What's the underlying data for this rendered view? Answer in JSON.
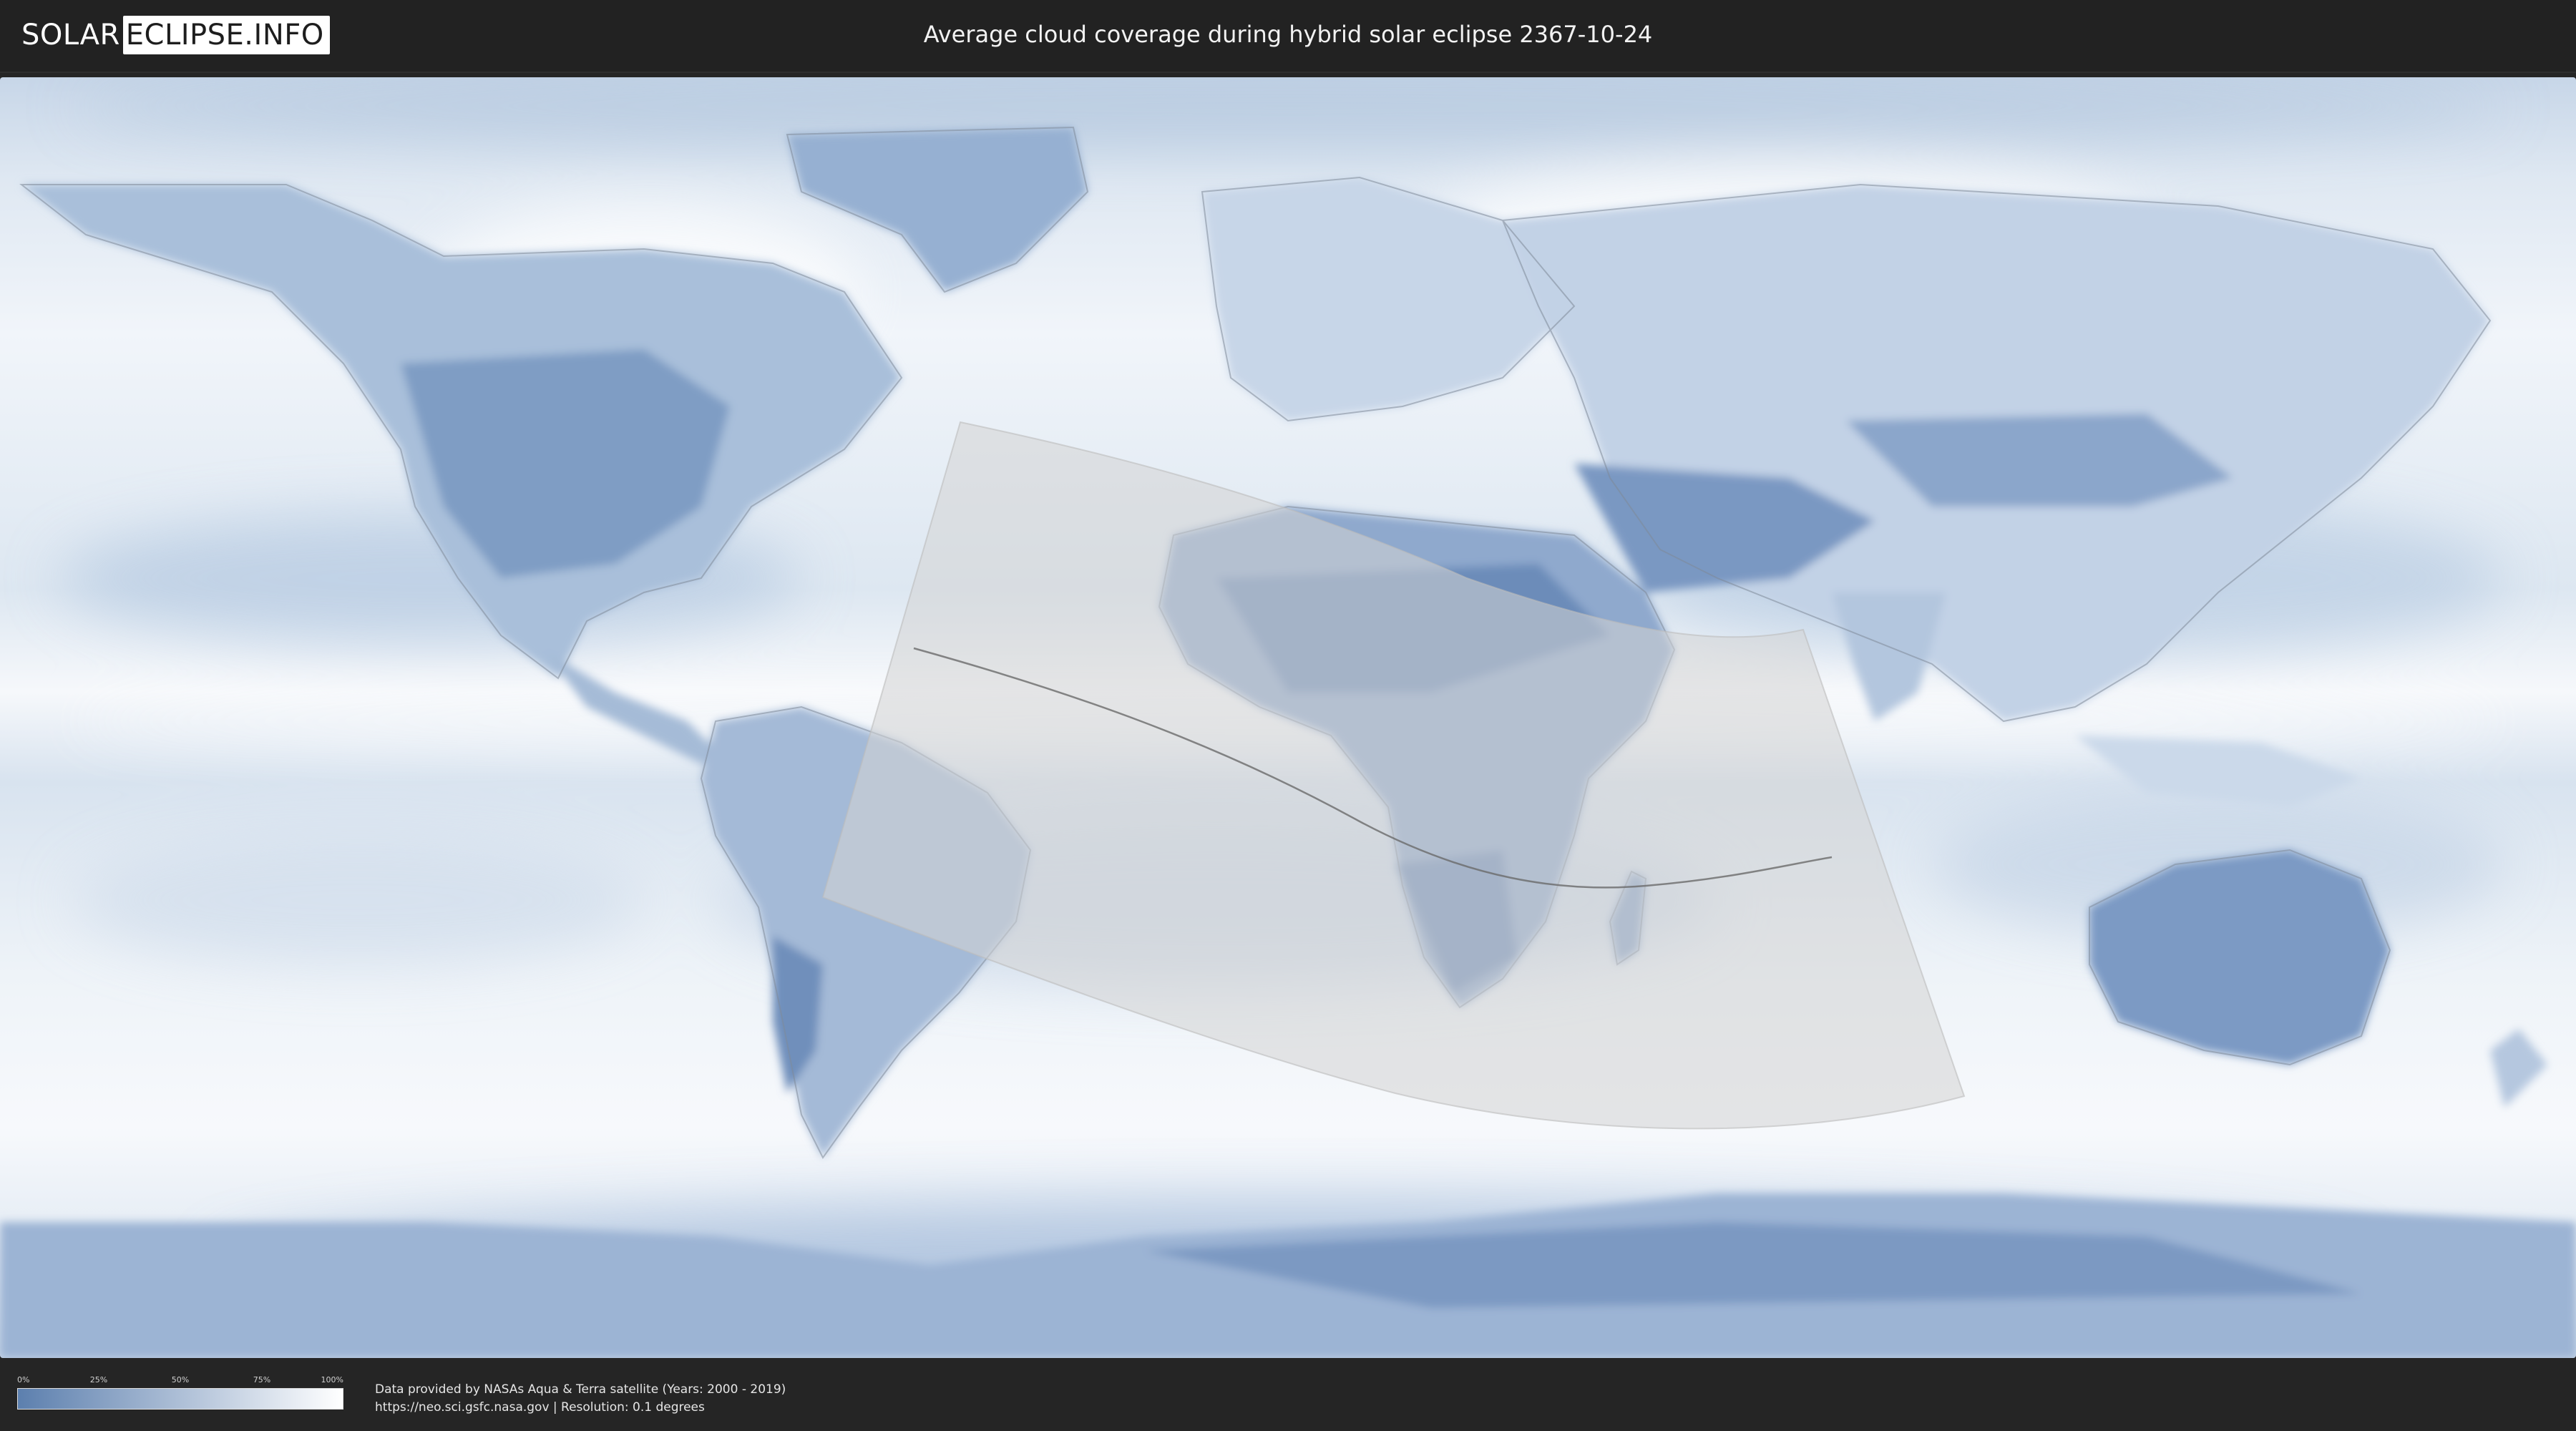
{
  "header": {
    "logo_left": "SOLAR",
    "logo_right": "ECLIPSE.INFO",
    "title": "Average cloud coverage during hybrid solar eclipse 2367-10-24"
  },
  "map": {
    "projection": "equirectangular world map",
    "layer": "average cloud coverage",
    "colors": {
      "cloud_low": "#5c7fae",
      "cloud_high": "#ffffff",
      "eclipse_overlay": "#d4d4d4",
      "central_line": "#6a6a6a"
    },
    "icons": [
      "world-map",
      "eclipse-visibility-zone",
      "eclipse-central-line"
    ]
  },
  "legend": {
    "ticks": [
      {
        "label": "0%",
        "value": 0
      },
      {
        "label": "25%",
        "value": 0.25
      },
      {
        "label": "50%",
        "value": 0.5
      },
      {
        "label": "75%",
        "value": 0.75
      },
      {
        "label": "100%",
        "value": 1
      }
    ],
    "color_low": "#5c7fae",
    "color_high": "#ffffff"
  },
  "credits": {
    "line1": "Data provided by NASAs Aqua & Terra satellite (Years: 2000 - 2019)",
    "line2": "https://neo.sci.gsfc.nasa.gov | Resolution: 0.1 degrees"
  }
}
